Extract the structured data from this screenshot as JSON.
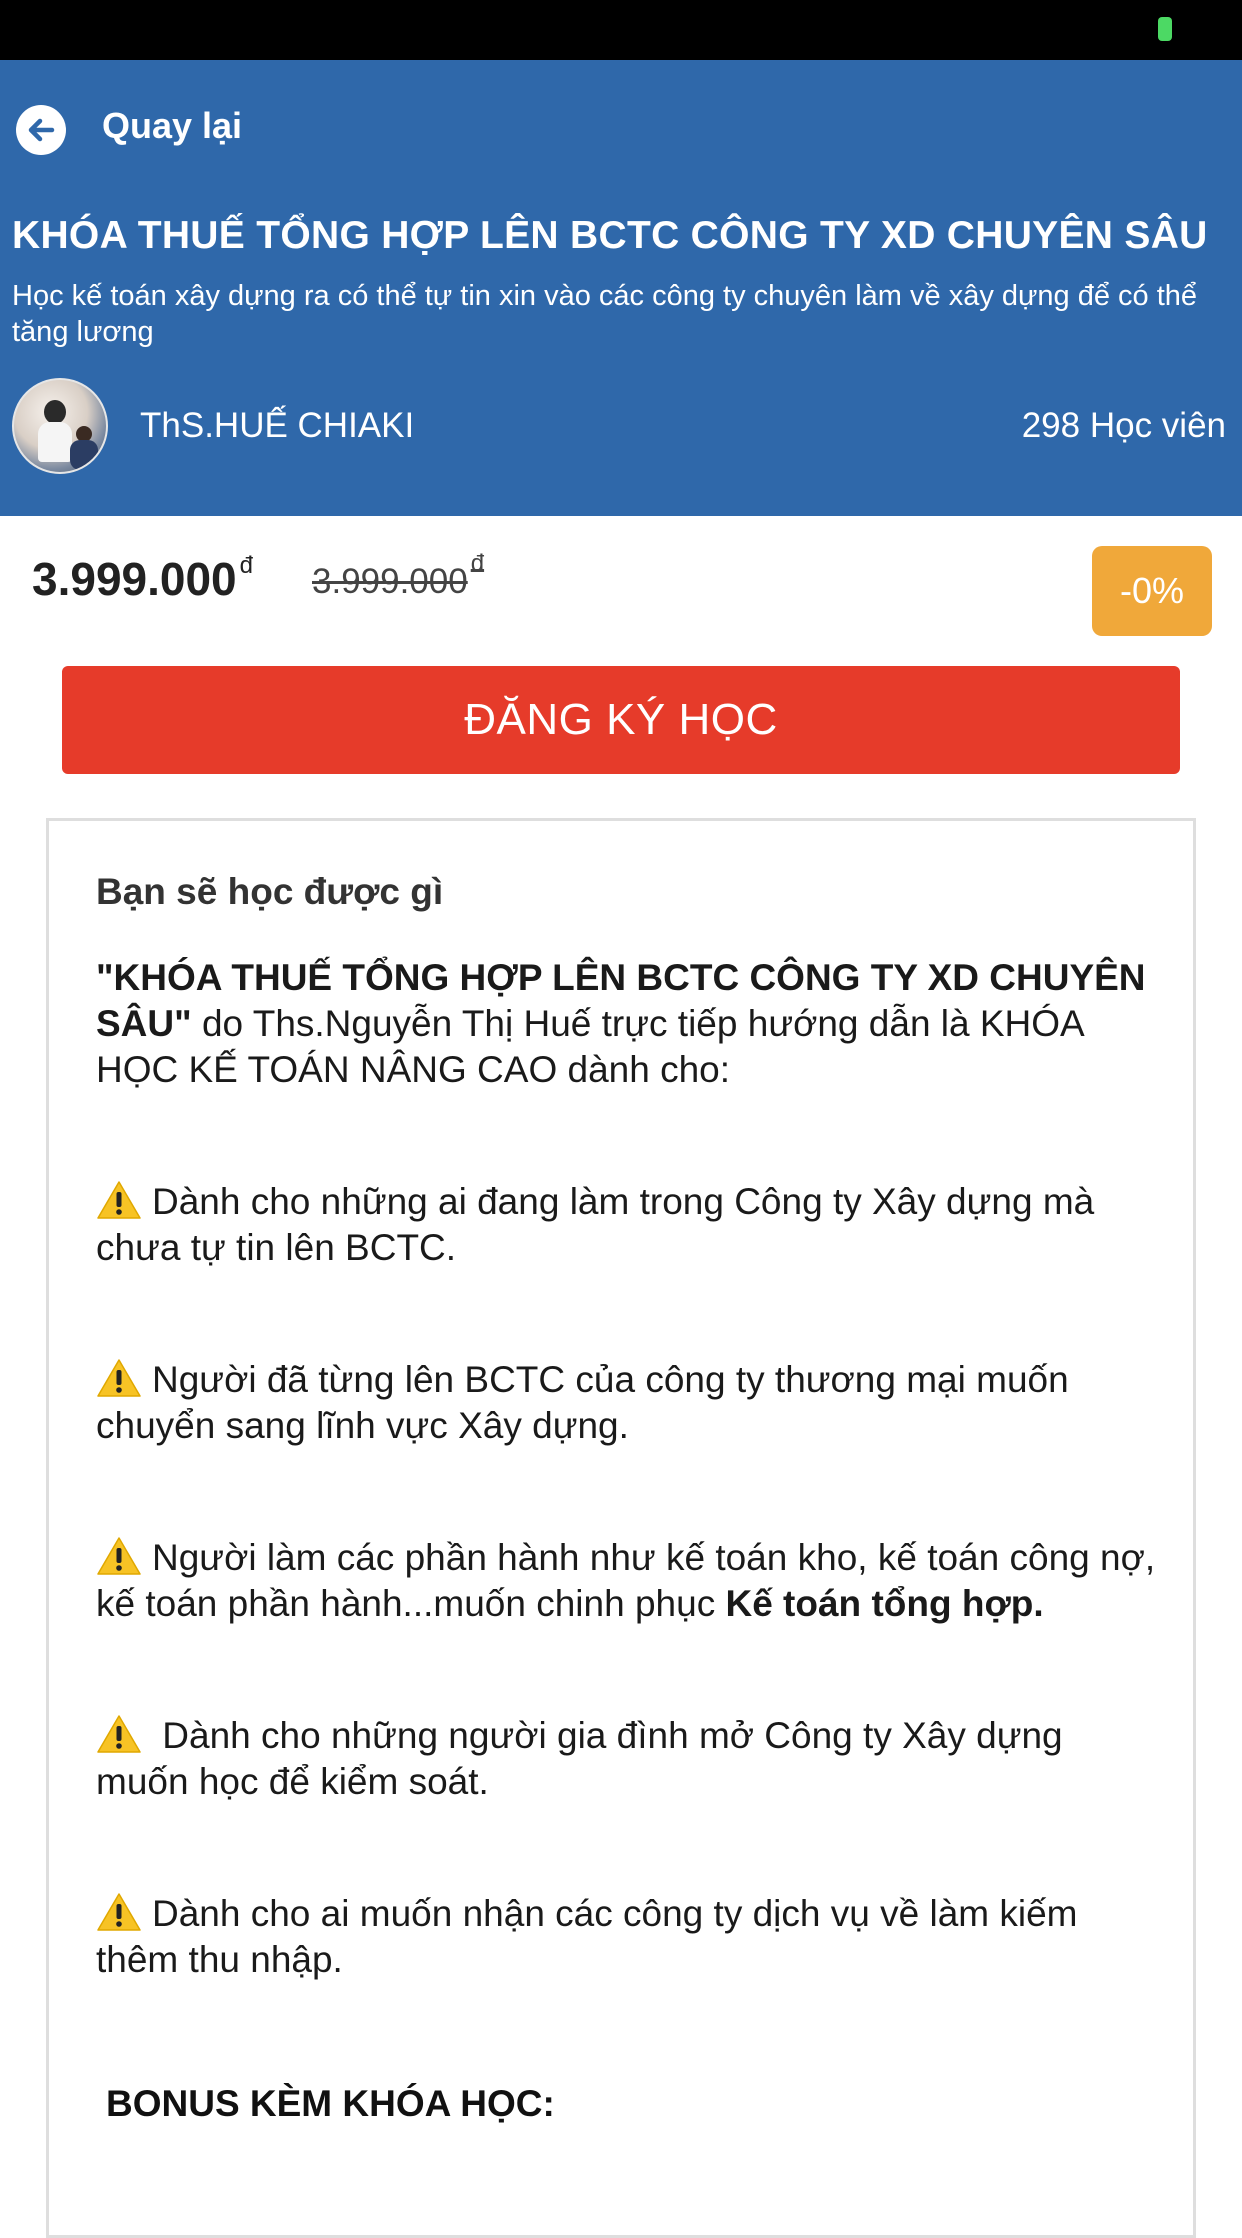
{
  "header": {
    "back_label": "Quay lại",
    "title": "KHÓA THUẾ TỔNG HỢP LÊN BCTC CÔNG TY XD CHUYÊN SÂU",
    "subtitle": "Học kế toán xây dựng ra có thể tự tin xin vào các công ty chuyên làm về xây dựng để có thể tăng lương",
    "author": "ThS.HUẾ CHIAKI",
    "students": "298 Học viên"
  },
  "pricing": {
    "current": "3.999.000",
    "original": "3.999.000",
    "currency_symbol": "đ",
    "discount": "-0%"
  },
  "register_button": "ĐĂNG KÝ HỌC",
  "content": {
    "heading": "Bạn sẽ học được gì",
    "intro_bold": "\"KHÓA THUẾ TỔNG HỢP LÊN BCTC CÔNG TY XD CHUYÊN SÂU\"",
    "intro_rest": " do Ths.Nguyễn Thị Huế trực tiếp hướng dẫn là KHÓA HỌC KẾ TOÁN NÂNG CAO dành cho:",
    "bullets": [
      "Dành cho những ai đang làm trong Công ty Xây dựng mà chưa tự tin lên BCTC.",
      "Người đã từng lên BCTC của công ty thương mại muốn chuyển sang lĩnh vực Xây dựng.",
      "Người làm các phần hành như kế toán kho, kế toán công nợ, kế toán phần hành...muốn chinh phục ",
      " Dành cho những người gia đình mở Công ty Xây dựng muốn học để kiểm soát.",
      "Dành cho ai muốn nhận các công ty dịch vụ về làm kiếm thêm thu nhập."
    ],
    "bullet3_bold": "Kế toán tổng hợp.",
    "bonus_heading": "BONUS KÈM KHÓA HỌC:"
  },
  "colors": {
    "header_bg": "#2f68aa",
    "register_bg": "#e63b2a",
    "discount_bg": "#f0a83a"
  },
  "icons": {
    "back": "arrow-left-icon",
    "bullet": "warning-icon"
  }
}
